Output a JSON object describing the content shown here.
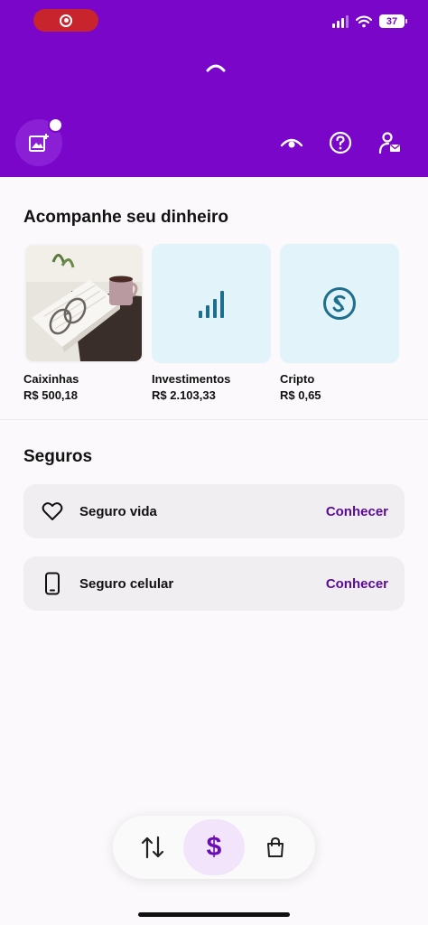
{
  "status_bar": {
    "battery": "37",
    "icons": [
      "screen-record-icon",
      "cellular-signal-icon",
      "wifi-icon",
      "battery-icon"
    ]
  },
  "header": {
    "icons": [
      "loading-spinner-icon",
      "add-photo-icon",
      "eye-icon",
      "help-icon",
      "profile-mail-icon"
    ],
    "background": "#7a06c9"
  },
  "money": {
    "title": "Acompanhe seu dinheiro",
    "cards": [
      {
        "label": "Caixinhas",
        "value": "R$ 500,18",
        "icon": "book-glasses-photo"
      },
      {
        "label": "Investimentos",
        "value": "R$ 2.103,33",
        "icon": "bar-chart-icon"
      },
      {
        "label": "Cripto",
        "value": "R$ 0,65",
        "icon": "crypto-coin-icon"
      }
    ]
  },
  "insurance": {
    "title": "Seguros",
    "items": [
      {
        "label": "Seguro vida",
        "action": "Conhecer",
        "icon": "heart-icon"
      },
      {
        "label": "Seguro celular",
        "action": "Conhecer",
        "icon": "phone-icon"
      }
    ]
  },
  "bottom_nav": {
    "active": "$",
    "items": [
      "transfer-arrows-icon",
      "dollar-icon",
      "shopping-bag-icon"
    ]
  }
}
